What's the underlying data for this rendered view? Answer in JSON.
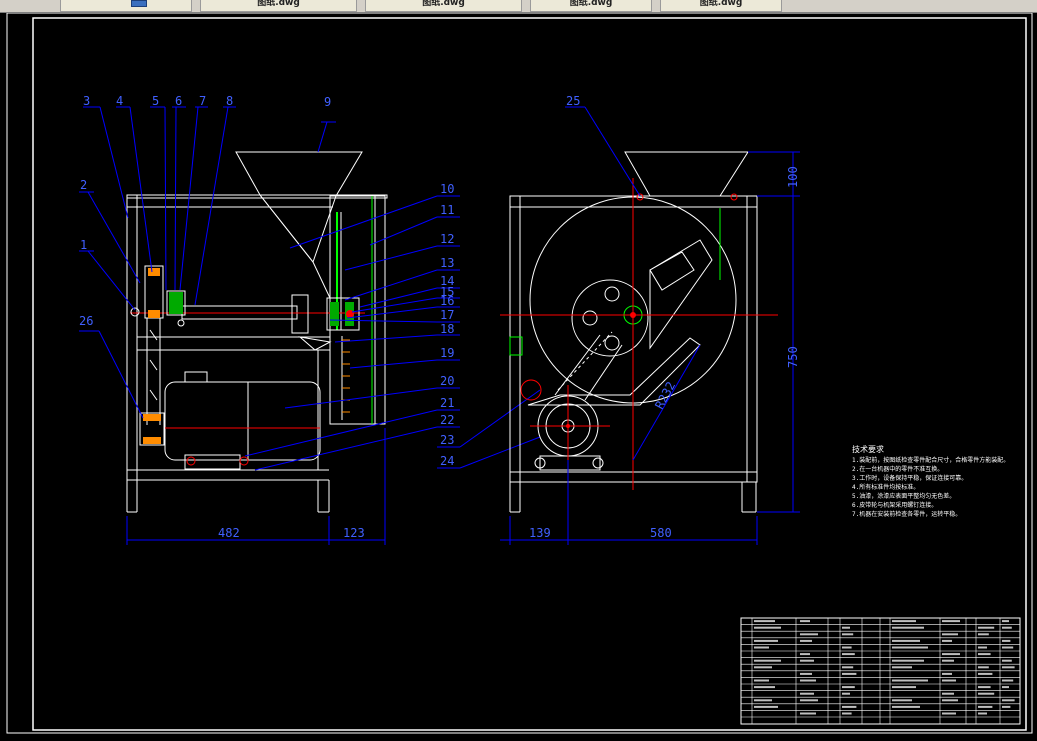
{
  "tabs": [
    {
      "label": ""
    },
    {
      "label": "图纸.dwg"
    },
    {
      "label": "图纸.dwg"
    },
    {
      "label": "图纸.dwg"
    },
    {
      "label": "图纸.dwg"
    }
  ],
  "colors": {
    "background": "#000000",
    "frame": "#ffffff",
    "leader": "#0000ff",
    "center": "#ff0000",
    "section": "#00ff00",
    "hatch": "#ff8c00"
  },
  "left_view": {
    "balloons": [
      "3",
      "4",
      "5",
      "6",
      "7",
      "8",
      "9",
      "2",
      "1",
      "26"
    ],
    "dim_bottom_1": "482",
    "dim_bottom_2": "123"
  },
  "middle_balloons": [
    "10",
    "11",
    "12",
    "13",
    "14",
    "15",
    "16",
    "17",
    "18",
    "19",
    "20",
    "21",
    "22",
    "23",
    "24"
  ],
  "right_view": {
    "balloon_top": "25",
    "dim_top": "100",
    "dim_height": "750",
    "dim_bottom_1": "139",
    "dim_bottom_2": "580",
    "dim_radius": "R232"
  },
  "notes": {
    "title": "技术要求",
    "lines": [
      "1.装配前，按图纸检查零件配合尺寸，合格零件方能装配。",
      "2.在一台机器中的零件不准互换。",
      "3.工作时，设备保持平稳，保证连接可靠。",
      "4.所有标准件均按标准。",
      "5.油漆，涂漆应表面平整均匀无色差。",
      "6.皮带轮与机架采用螺钉连接。",
      "7.机器在安装前检查各零件，运转平稳。"
    ]
  }
}
